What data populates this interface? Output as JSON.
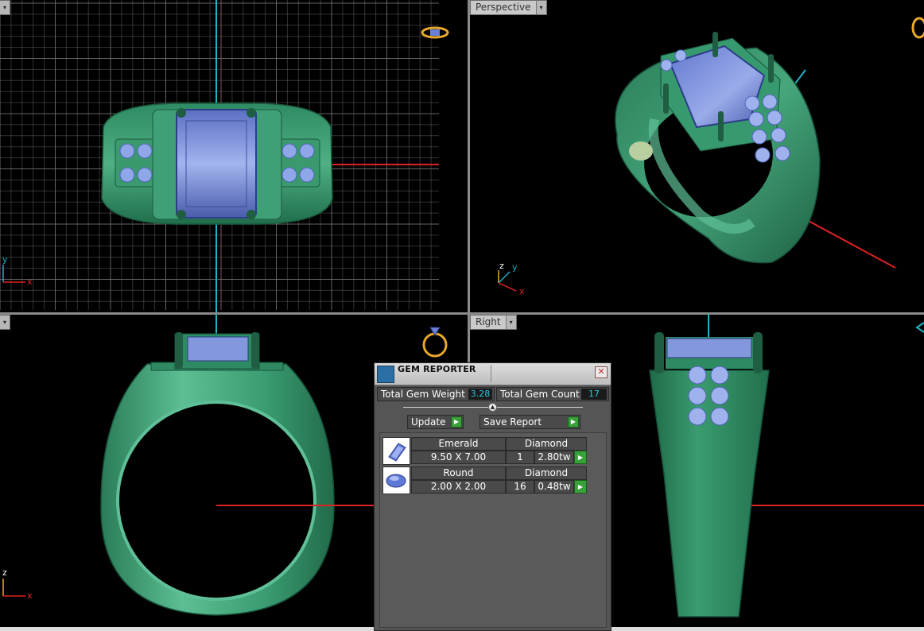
{
  "viewports": {
    "top": {
      "label": "",
      "axis_x": "x",
      "axis_y": "y"
    },
    "perspective": {
      "label": "Perspective",
      "axis_x": "x",
      "axis_y": "y",
      "axis_z": "z"
    },
    "front": {
      "label": "",
      "axis_x": "x",
      "axis_z": "z"
    },
    "right": {
      "label": "Right"
    }
  },
  "gem_reporter": {
    "title": "GEM REPORTER",
    "close_symbol": "✕",
    "total_weight_label": "Total Gem Weight",
    "total_weight_value": "3.28",
    "total_count_label": "Total Gem Count",
    "total_count_value": "17",
    "update_label": "Update",
    "save_report_label": "Save Report",
    "gems": [
      {
        "shape": "Emerald",
        "material": "Diamond",
        "size": "9.50 X 7.00",
        "count": "1",
        "weight": "2.80tw",
        "icon": "emerald-cut-gem-icon"
      },
      {
        "shape": "Round",
        "material": "Diamond",
        "size": "2.00 X 2.00",
        "count": "16",
        "weight": "0.48tw",
        "icon": "round-cut-gem-icon"
      }
    ]
  },
  "colors": {
    "metal": "#2e8a62",
    "metal_light": "#5cc095",
    "gem": "#7d93e0",
    "grid": "#7a7a7a",
    "axis_x": "#d22",
    "axis_y": "#1fb3c7",
    "accent_button": "#39a13a",
    "value_text": "#2ec7e0"
  }
}
